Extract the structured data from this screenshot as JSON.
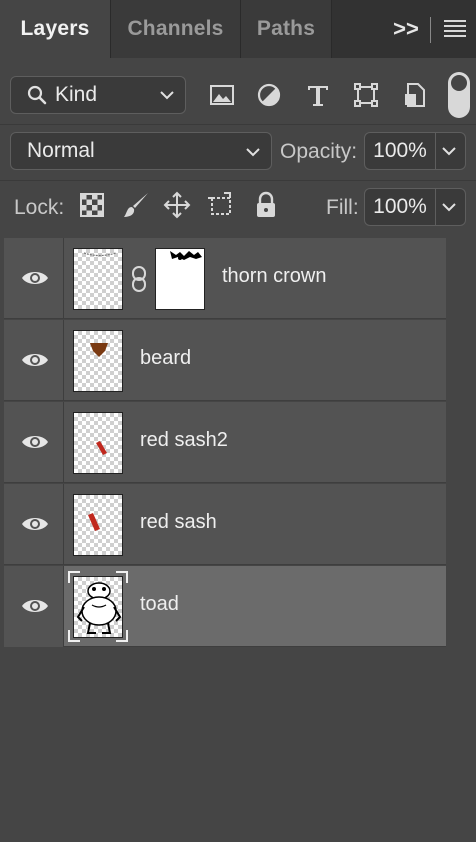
{
  "tabs": [
    {
      "label": "Layers",
      "active": true
    },
    {
      "label": "Channels",
      "active": false
    },
    {
      "label": "Paths",
      "active": false
    }
  ],
  "tab_overflow": ">>",
  "filter": {
    "kind_label": "Kind",
    "icons": [
      "image-filter-icon",
      "adjustment-filter-icon",
      "type-filter-icon",
      "shape-filter-icon",
      "smart-object-filter-icon"
    ]
  },
  "blend": {
    "mode": "Normal",
    "opacity_label": "Opacity:",
    "opacity_value": "100%"
  },
  "lock": {
    "label": "Lock:",
    "fill_label": "Fill:",
    "fill_value": "100%"
  },
  "layers": [
    {
      "name": "thorn crown",
      "visible": true,
      "has_mask": true,
      "selected": false
    },
    {
      "name": "beard",
      "visible": true,
      "has_mask": false,
      "selected": false
    },
    {
      "name": "red sash2",
      "visible": true,
      "has_mask": false,
      "selected": false
    },
    {
      "name": "red sash",
      "visible": true,
      "has_mask": false,
      "selected": false
    },
    {
      "name": "toad",
      "visible": true,
      "has_mask": false,
      "selected": true
    }
  ],
  "colors": {
    "panel_bg": "#454545",
    "layer_row": "#535353",
    "layer_selected": "#6b6b6b",
    "beard": "#7a3a12",
    "sash": "#c0281e"
  }
}
